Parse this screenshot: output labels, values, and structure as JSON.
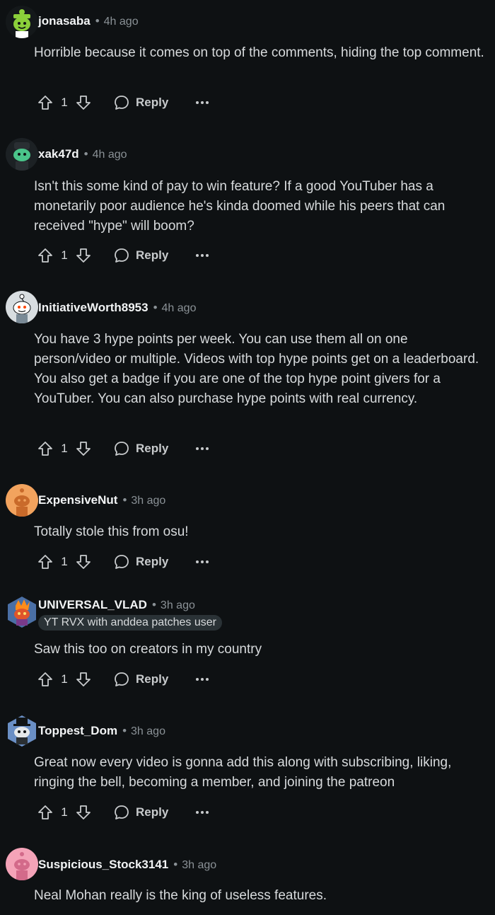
{
  "comments": [
    {
      "username": "jonasaba",
      "time": "4h ago",
      "body": "Horrible because it comes on top of the comments, hiding the top comment.",
      "votes": "1",
      "reply_label": "Reply"
    },
    {
      "username": "xak47d",
      "time": "4h ago",
      "body": "Isn't this some kind of pay to win feature? If a good YouTuber has a monetarily poor audience he's kinda doomed while his peers that can received \"hype\" will boom?",
      "votes": "1",
      "reply_label": "Reply"
    },
    {
      "username": "InitiativeWorth8953",
      "time": "4h ago",
      "body": "You have 3 hype points per week. You can use them all on one person/video or multiple. Videos with top hype points get on a leaderboard. You also get a badge if you are one of the top hype point givers for a YouTuber. You can also purchase hype points with real currency.",
      "votes": "1",
      "reply_label": "Reply"
    },
    {
      "username": "ExpensiveNut",
      "time": "3h ago",
      "body": "Totally stole this from osu!",
      "votes": "1",
      "reply_label": "Reply"
    },
    {
      "username": "UNIVERSAL_VLAD",
      "time": "3h ago",
      "flair": "YT RVX with anddea patches user",
      "body": "Saw this too on creators in my country",
      "votes": "1",
      "reply_label": "Reply"
    },
    {
      "username": "Toppest_Dom",
      "time": "3h ago",
      "body": "Great now every video is gonna add this along with subscribing, liking, ringing the bell, becoming a member, and joining the patreon",
      "votes": "1",
      "reply_label": "Reply"
    },
    {
      "username": "Suspicious_Stock3141",
      "time": "3h ago",
      "body": "Neal Mohan really is the king of useless features."
    }
  ],
  "separator": "•",
  "colors": {
    "background": "#0e1113",
    "text": "#d7dadc",
    "muted": "#8a9196",
    "flair_bg": "#2a3236"
  },
  "icons": {
    "upvote": "upvote-arrow-icon",
    "downvote": "downvote-arrow-icon",
    "reply": "speech-bubble-icon",
    "more": "ellipsis-icon"
  }
}
